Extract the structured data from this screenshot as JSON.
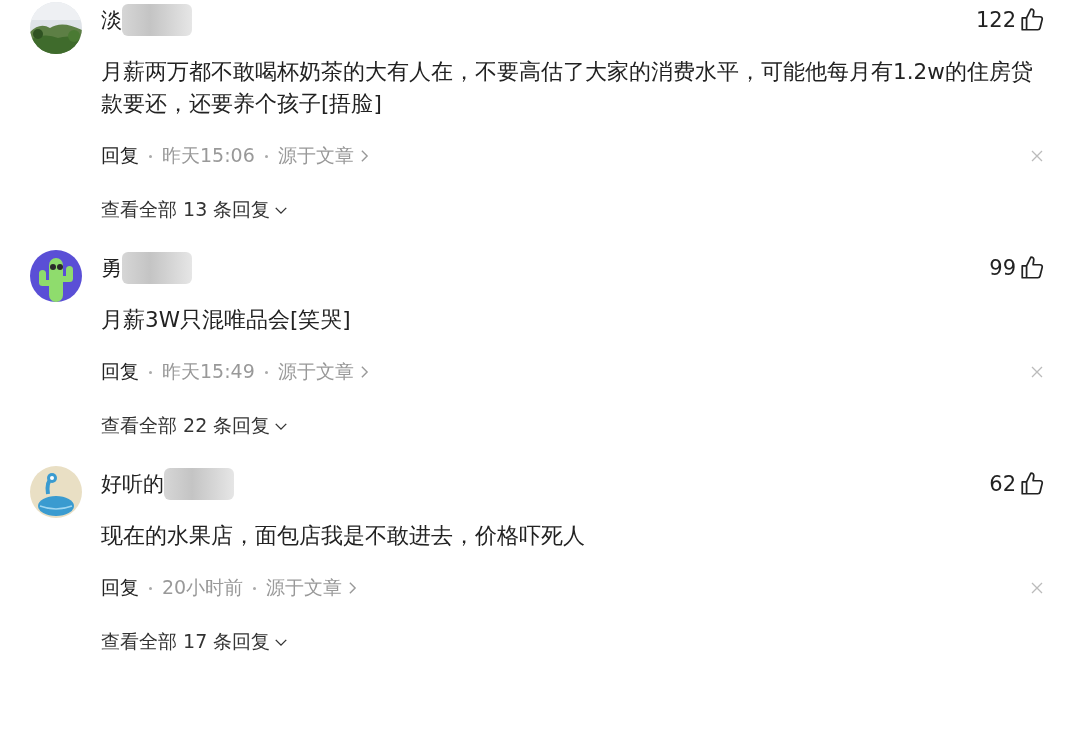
{
  "comments": [
    {
      "name": "淡",
      "likes": "122",
      "text": "月薪两万都不敢喝杯奶茶的大有人在，不要高估了大家的消费水平，可能他每月有1.2w的住房贷款要还，还要养个孩子[捂脸]",
      "reply": "回复",
      "time": "昨天15:06",
      "source": "源于文章",
      "view_all": "查看全部 13 条回复"
    },
    {
      "avatar": {
        "kind": "cactus"
      },
      "name": "勇",
      "likes": "99",
      "text": "月薪3W只混唯品会[笑哭]",
      "reply": "回复",
      "time": "昨天15:49",
      "source": "源于文章",
      "view_all": "查看全部 22 条回复"
    },
    {
      "avatar": {
        "kind": "alien"
      },
      "name": "好听的",
      "likes": "62",
      "text": "现在的水果店，面包店我是不敢进去，价格吓死人",
      "reply": "回复",
      "time": "20小时前",
      "source": "源于文章",
      "view_all": "查看全部 17 条回复"
    }
  ]
}
